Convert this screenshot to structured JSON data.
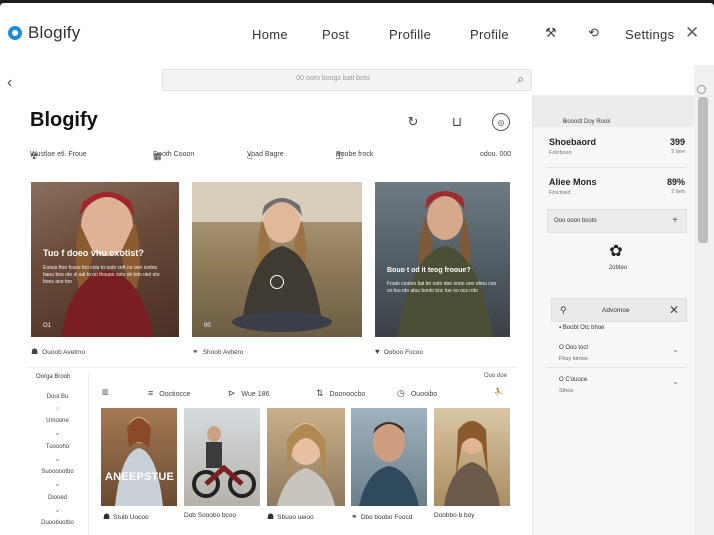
{
  "app": {
    "name": "Blogify"
  },
  "nav": {
    "items": [
      "Home",
      "Post",
      "Profille",
      "Profile"
    ],
    "settings": "Settings",
    "icons": [
      "tools-icon",
      "link-icon",
      "close-icon"
    ]
  },
  "search": {
    "placeholder": "00 ooro boogz bati boto"
  },
  "page": {
    "title": "Blogify"
  },
  "filters": {
    "items": [
      "Wustloe etl. Froue",
      "Dooth Cooon",
      "Voad Bagre",
      "Boobe frock"
    ],
    "right": "odou. 000"
  },
  "cards": [
    {
      "headline": "Tuo f doeo vhu cxotist?",
      "body": "Eoouo ftoo fcuso foo colu to ooto ceft oo oen sodoo baou boo ote sl oal to oo thouoo ceto ok toto otel oto boos aoo too",
      "tag": "O1",
      "meta": "Ouoob Avetmo"
    },
    {
      "headline": "",
      "body": "",
      "tag": "00",
      "meta": "Shoob Avbero"
    },
    {
      "headline": "Bouo t od it teog frooue?",
      "body": "Fouto coutoo bai bo ooto doe onoo ooo obou coo oo loo oto atou bonto boc toe oo ocs roto",
      "tag": "",
      "meta": "Ooboo Focoo"
    }
  ],
  "lower": {
    "sidebar_title": "Oorga Brooh",
    "sidebar_items": [
      "Dout Bu",
      "Umoone",
      "Tuoooho",
      "Suoooootbo",
      "Diooed",
      "Duoobuotbo"
    ],
    "tools": [
      "Ooctiocce",
      "Wue 186",
      "Doonoocbo",
      "Ouooibo"
    ],
    "right_label": "Ouo doe",
    "thumbs": [
      {
        "overlay": "ANEEPSTUE",
        "meta": "Stuib Uocoo"
      },
      {
        "overlay": "",
        "meta": "Dob Sooobo bcoo"
      },
      {
        "overlay": "",
        "meta": "Sbuoo ueioo"
      },
      {
        "overlay": "",
        "meta": "Dbo boobo Foocd"
      },
      {
        "overlay": "",
        "meta": "Doobbo b boy"
      }
    ]
  },
  "rpanel": {
    "header": "Dooodt Doy Rook",
    "stats": [
      {
        "name": "Shoebaord",
        "sub": "Fotcboso",
        "pct": "399",
        "rank": "2 bee"
      },
      {
        "name": "Aliee Mons",
        "sub": "Ftoctoed",
        "pct": "89%",
        "rank": "2 beb"
      }
    ],
    "box": "Ooo ooon bsoto",
    "flower_label": "2obteo",
    "advanced": "Advomoe",
    "advanced_sub": "Boobt Otc bhoe",
    "dropdowns": [
      {
        "label": "O Ooo toct",
        "value": "Fhuy lotnoo"
      },
      {
        "label": "O C'ouoce",
        "value": "Sthos"
      }
    ]
  },
  "colors": {
    "accent": "#1a8fd8"
  }
}
